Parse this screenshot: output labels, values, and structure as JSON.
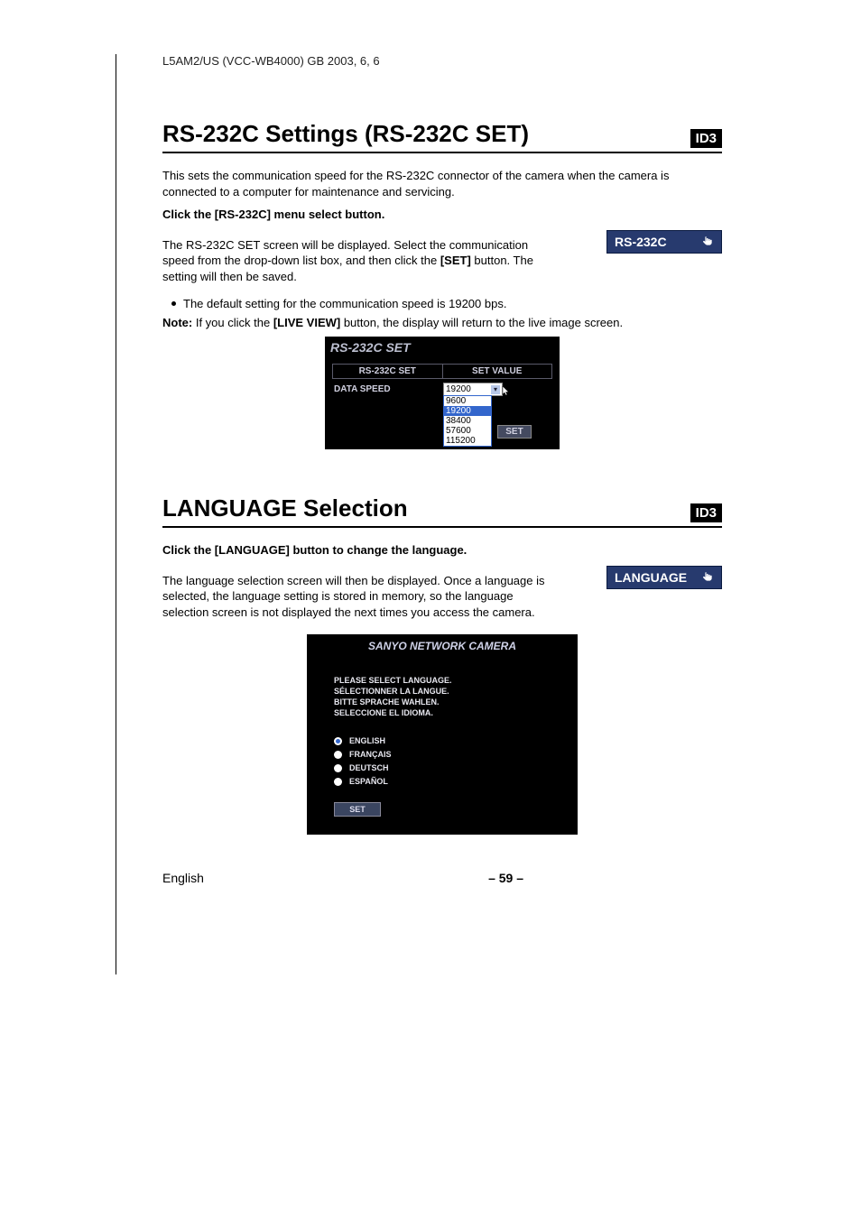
{
  "header": "L5AM2/US (VCC-WB4000)    GB    2003, 6, 6",
  "id_badge": "ID3",
  "section1": {
    "title": "RS-232C Settings (RS-232C SET)",
    "intro": "This sets the communication speed for the RS-232C connector of the camera when the camera is connected to a computer for maintenance and servicing.",
    "step_bold": "Click the [RS-232C] menu select button.",
    "desc_a": "The RS-232C SET screen will be displayed. Select the communication speed from the drop-down list box, and then click the ",
    "desc_set": "[SET]",
    "desc_b": " button. The setting will then be saved.",
    "bullet": "The default setting for the communication speed is 19200 bps.",
    "note_label": "Note:",
    "note_a": "If you click the ",
    "note_live": "[LIVE VIEW]",
    "note_b": " button, the display will return to the live image screen.",
    "menu_button": "RS-232C",
    "scr_title": "RS-232C SET",
    "scr_head1": "RS-232C SET",
    "scr_head2": "SET VALUE",
    "scr_label": "DATA SPEED",
    "scr_selected": "19200",
    "scr_options": [
      "9600",
      "19200",
      "38400",
      "57600",
      "115200"
    ],
    "scr_setbtn": "SET"
  },
  "section2": {
    "title": "LANGUAGE Selection",
    "step_bold": "Click the [LANGUAGE] button to change the language.",
    "desc": "The language selection screen will then be displayed. Once a language is selected, the language setting is stored in memory, so the language selection screen is not displayed the next times you access the camera.",
    "menu_button": "LANGUAGE",
    "scr_title": "SANYO NETWORK CAMERA",
    "scr_instructions": [
      "PLEASE SELECT LANGUAGE.",
      "SÉLECTIONNER LA LANGUE.",
      "BITTE SPRACHE WAHLEN.",
      "SELECCIONE EL IDIOMA."
    ],
    "scr_langs": [
      "ENGLISH",
      "FRANÇAIS",
      "DEUTSCH",
      "ESPAÑOL"
    ],
    "scr_selected_index": 0,
    "scr_setbtn": "SET"
  },
  "footer": {
    "lang": "English",
    "page": "– 59 –"
  }
}
